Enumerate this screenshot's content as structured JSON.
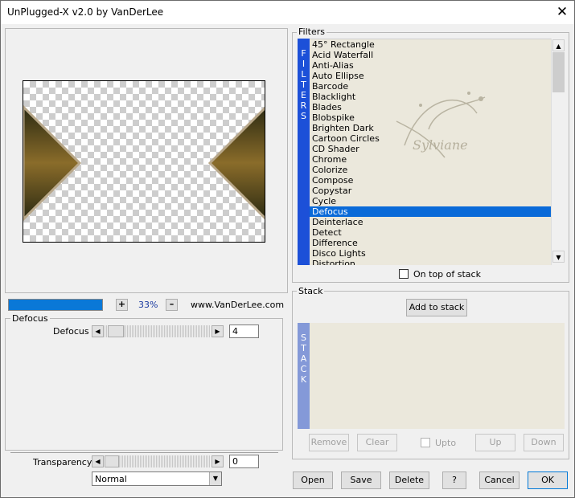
{
  "window": {
    "title": "UnPlugged-X v2.0 by VanDerLee",
    "close_glyph": "✕"
  },
  "preview": {
    "progress_fraction": 1.0
  },
  "zoom": {
    "plus": "+",
    "value": "33%",
    "minus": "–",
    "website": "www.VanDerLee.com"
  },
  "filters": {
    "group_label": "Filters",
    "vertical_label": [
      "F",
      "I",
      "L",
      "T",
      "E",
      "R",
      "S"
    ],
    "items": [
      "45° Rectangle",
      "Acid Waterfall",
      "Anti-Alias",
      "Auto Ellipse",
      "Barcode",
      "Blacklight",
      "Blades",
      "Blobspike",
      "Brighten Dark",
      "Cartoon Circles",
      "CD Shader",
      "Chrome",
      "Colorize",
      "Compose",
      "Copystar",
      "Cycle",
      "Defocus",
      "Deinterlace",
      "Detect",
      "Difference",
      "Disco Lights",
      "Distortion"
    ],
    "selected": "Defocus",
    "on_top_label": "On top of stack"
  },
  "watermark": {
    "text": "Sylviane"
  },
  "param_group": {
    "label": "Defocus",
    "defocus_label": "Defocus",
    "defocus_value": "4",
    "defocus_slider_fraction": 0.04
  },
  "transparency": {
    "label": "Transparency",
    "value": "0",
    "slider_fraction": 0.0,
    "blend_mode": "Normal"
  },
  "stack": {
    "group_label": "Stack",
    "add_button": "Add to stack",
    "vertical_label": [
      "S",
      "T",
      "A",
      "C",
      "K"
    ],
    "remove": "Remove",
    "clear": "Clear",
    "upto": "Upto",
    "up": "Up",
    "down": "Down"
  },
  "footer": {
    "open": "Open",
    "save": "Save",
    "delete": "Delete",
    "help": "?",
    "cancel": "Cancel",
    "ok": "OK"
  },
  "colors": {
    "selection": "#0a6ad8",
    "vertical_bar": "#1c50d8",
    "list_bg": "#ebe8dc",
    "stack_bar": "#8499d8"
  }
}
